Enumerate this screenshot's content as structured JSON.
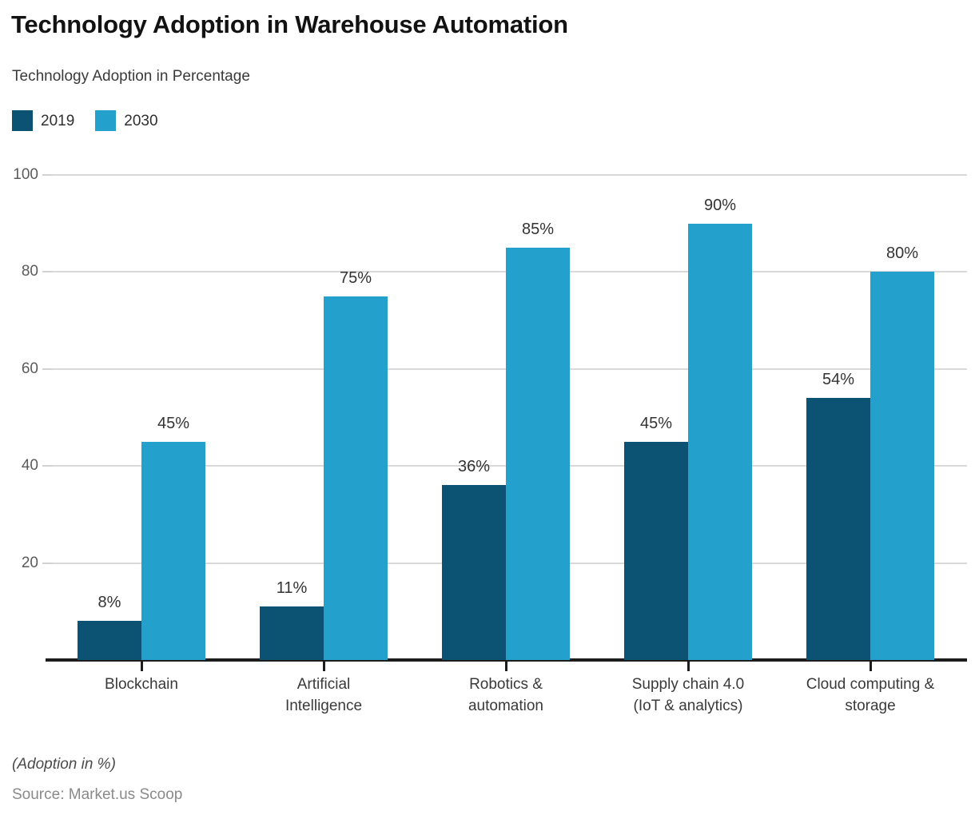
{
  "header": {
    "title": "Technology Adoption in Warehouse Automation",
    "subtitle": "Technology Adoption in Percentage"
  },
  "legend": {
    "position": "top-left",
    "items": [
      {
        "label": "2019",
        "color": "#0b5273"
      },
      {
        "label": "2030",
        "color": "#23a0cc"
      }
    ]
  },
  "footer": {
    "note": "(Adoption in %)",
    "source": "Source: Market.us Scoop"
  },
  "colors": {
    "series_2019": "#0b5273",
    "series_2030": "#23a0cc",
    "gridline": "#d9d9d9",
    "axis": "#1d1d1d",
    "title_text": "#121212",
    "tick_text": "#5b5b5b",
    "source_text": "#8a8a8a"
  },
  "chart_data": {
    "type": "bar",
    "title": "Technology Adoption in Warehouse Automation",
    "subtitle": "Technology Adoption in Percentage",
    "xlabel": "",
    "ylabel": "",
    "ylim": [
      0,
      100
    ],
    "yticks": [
      20,
      40,
      60,
      80,
      100
    ],
    "ytick_labels": [
      "20",
      "40",
      "60",
      "80",
      "100"
    ],
    "grid": true,
    "legend_position": "top-left",
    "categories": [
      "Blockchain",
      "Artificial Intelligence",
      "Robotics & automation",
      "Supply chain 4.0 (IoT & analytics)",
      "Cloud computing & storage"
    ],
    "category_lines": [
      [
        "Blockchain"
      ],
      [
        "Artificial",
        "Intelligence"
      ],
      [
        "Robotics &",
        "automation"
      ],
      [
        "Supply chain 4.0",
        "(IoT & analytics)"
      ],
      [
        "Cloud computing &",
        "storage"
      ]
    ],
    "series": [
      {
        "name": "2019",
        "color": "#0b5273",
        "values": [
          8,
          11,
          36,
          45,
          54
        ],
        "labels": [
          "8%",
          "11%",
          "36%",
          "45%",
          "54%"
        ]
      },
      {
        "name": "2030",
        "color": "#23a0cc",
        "values": [
          45,
          75,
          85,
          90,
          80
        ],
        "labels": [
          "45%",
          "75%",
          "85%",
          "90%",
          "80%"
        ]
      }
    ],
    "annotations": [
      "(Adoption in %)",
      "Source: Market.us Scoop"
    ]
  }
}
